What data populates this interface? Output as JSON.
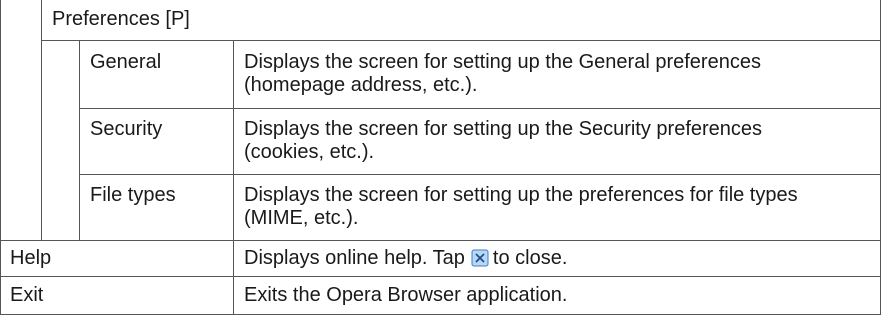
{
  "section": {
    "title": "Preferences [P]",
    "items": [
      {
        "name": "General",
        "description": "Displays the screen for setting up the General preferences (homepage address, etc.)."
      },
      {
        "name": "Security",
        "description": "Displays the screen for setting up the Security preferences (cookies, etc.)."
      },
      {
        "name": "File types",
        "description": "Displays the screen for setting up the preferences for file types (MIME, etc.)."
      }
    ]
  },
  "rows": [
    {
      "name": "Help",
      "description_before": "Displays online help. Tap",
      "icon": "close-icon",
      "description_after": "to close."
    },
    {
      "name": "Exit",
      "description": "Exits the Opera Browser application."
    }
  ],
  "colors": {
    "border": "#555555",
    "icon_fill": "#b9d7f5",
    "icon_stroke": "#3b7ec8"
  }
}
